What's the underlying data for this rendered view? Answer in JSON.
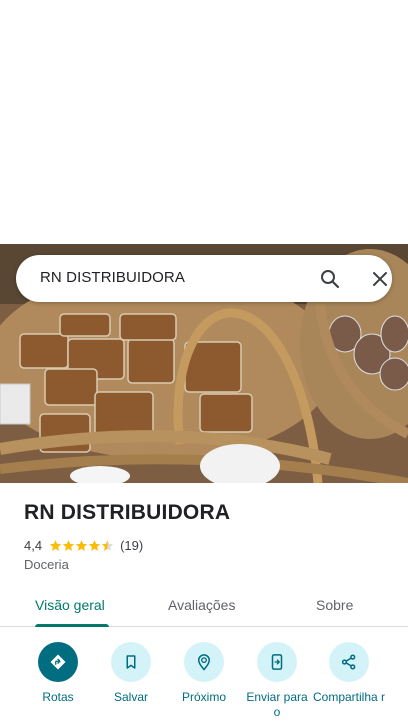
{
  "search": {
    "query": "RN DISTRIBUIDORA"
  },
  "place": {
    "title": "RN DISTRIBUIDORA",
    "rating": "4,4",
    "rating_fraction": 0.88,
    "review_count": "(19)",
    "category": "Doceria"
  },
  "tabs": [
    {
      "label": "Visão geral",
      "active": true
    },
    {
      "label": "Avaliações",
      "active": false
    },
    {
      "label": "Sobre",
      "active": false
    }
  ],
  "actions": [
    {
      "label": "Rotas",
      "icon": "directions-icon"
    },
    {
      "label": "Salvar",
      "icon": "bookmark-icon"
    },
    {
      "label": "Próximo",
      "icon": "nearby-icon"
    },
    {
      "label": "Enviar para o",
      "icon": "send-to-phone-icon"
    },
    {
      "label": "Compartilha r",
      "icon": "share-icon"
    }
  ],
  "colors": {
    "accent": "#00796b",
    "action_primary": "#006d80",
    "action_bg": "#d4f3f8",
    "star": "#fbbc04"
  }
}
